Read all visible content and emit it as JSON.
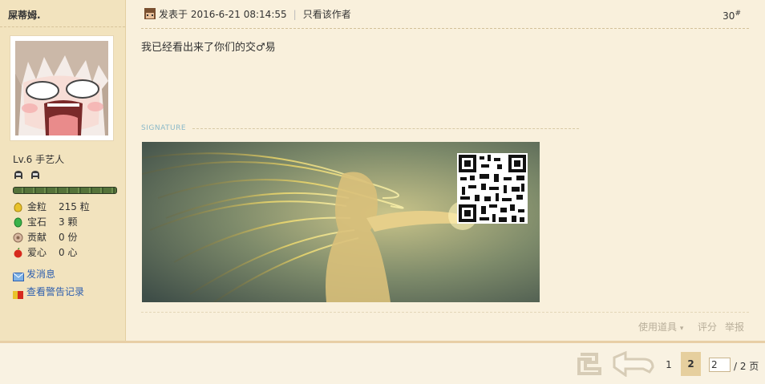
{
  "user": {
    "name": "屎蒂姆.",
    "level": "Lv.6 手艺人",
    "stats": [
      {
        "icon": "gold-bean-icon",
        "label": "金粒",
        "value": "215 粒"
      },
      {
        "icon": "gem-icon",
        "label": "宝石",
        "value": "3 颗"
      },
      {
        "icon": "contribution-icon",
        "label": "贡献",
        "value": "0 份"
      },
      {
        "icon": "love-icon",
        "label": "爱心",
        "value": "0 心"
      }
    ],
    "links": [
      {
        "icon": "message-icon",
        "label": "发消息"
      },
      {
        "icon": "warning-record-icon",
        "label": "查看警告记录"
      }
    ],
    "level_progress": 1.0
  },
  "post": {
    "posted_at": "发表于 2016-6-21 08:14:55",
    "only_author": "只看该作者",
    "floor_number": "30",
    "floor_mark": "#",
    "body": "我已经看出来了你们的交♂易",
    "signature_label": "SIGNATURE",
    "actions": {
      "use_item": "使用道具",
      "use_item_arrow": "▾",
      "rate": "评分",
      "report": "举报"
    }
  },
  "pager": {
    "pages": [
      "1",
      "2"
    ],
    "current_page": "2",
    "input_value": "2",
    "total": "/ 2 页"
  },
  "colors": {
    "background": "#f9f0dc",
    "sidebar": "#f2e3be",
    "link": "#2e5fae",
    "current_page_bg": "#e6cf9e"
  }
}
